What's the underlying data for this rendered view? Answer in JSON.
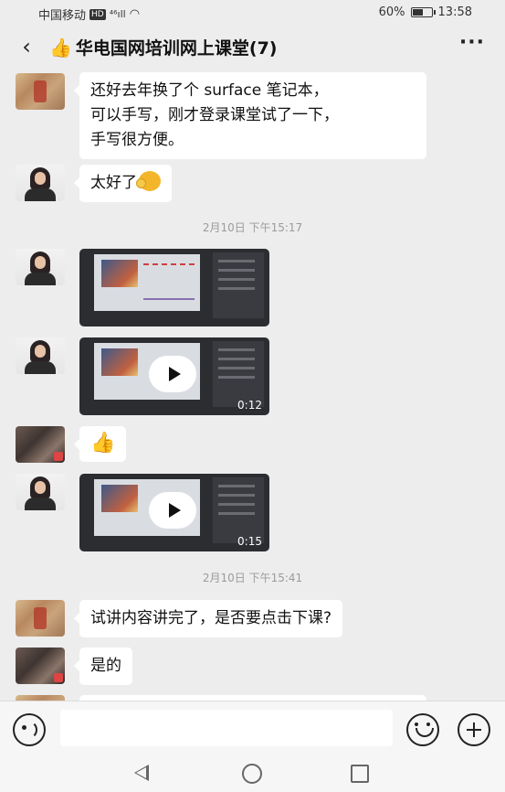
{
  "status_bar": {
    "carrier": "中国移动",
    "hd_badge": "HD",
    "signal": "⁴⁶ıll",
    "wifi": "◠",
    "battery_percent": "60%",
    "battery_level": 0.6,
    "time": "13:58"
  },
  "nav": {
    "back_icon": "‹",
    "title_emoji": "👍",
    "title": "华电国网培训网上课堂(7)",
    "more_icon": "···"
  },
  "messages": [
    {
      "type": "text",
      "avatar": "blurred-avatar",
      "lines": [
        "还好去年换了个 surface 笔记本，",
        "可以手写，刚才登录课堂试了一下，",
        "手写很方便。"
      ]
    },
    {
      "type": "text",
      "avatar": "woman-avatar",
      "text": "太好了"
    },
    {
      "type": "timestamp",
      "text": "2月10日 下午15:17"
    },
    {
      "type": "image",
      "avatar": "woman-avatar"
    },
    {
      "type": "video",
      "avatar": "woman-avatar",
      "duration": "0:12"
    },
    {
      "type": "sticker",
      "avatar": "dark-avatar",
      "text": "👍"
    },
    {
      "type": "video",
      "avatar": "woman-avatar",
      "duration": "0:15"
    },
    {
      "type": "timestamp",
      "text": "2月10日 下午15:41"
    },
    {
      "type": "text",
      "avatar": "blurred-avatar",
      "text": "试讲内容讲完了，是否要点击下课?"
    },
    {
      "type": "text",
      "avatar": "dark-avatar",
      "text": "是的"
    }
  ],
  "input_bar": {
    "placeholder": ""
  },
  "colors": {
    "background": "#ededed",
    "bubble": "#ffffff",
    "timestamp": "#9b9b9b"
  }
}
